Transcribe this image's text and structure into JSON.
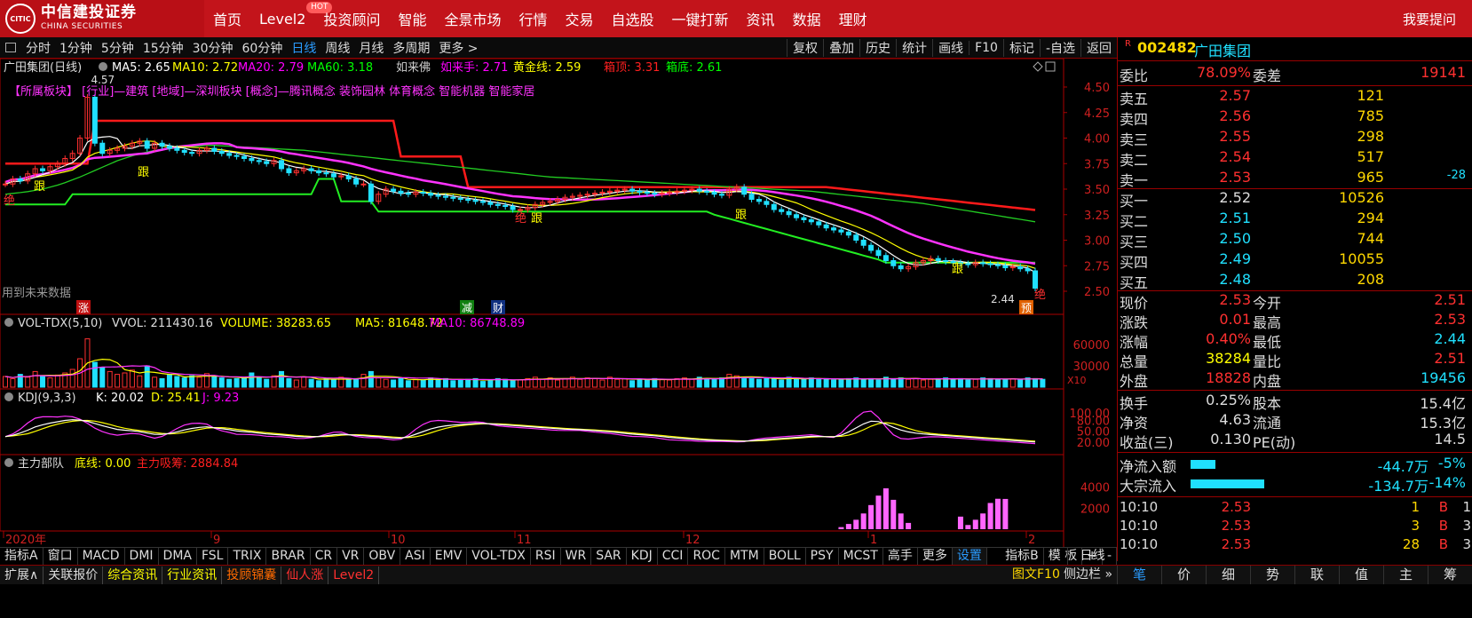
{
  "brand": {
    "logo_mark": "CITIC",
    "name_cn": "中信建投证券",
    "name_en": "CHINA SECURITIES"
  },
  "nav": [
    {
      "label": "首页"
    },
    {
      "label": "Level2",
      "badge": "HOT"
    },
    {
      "label": "投资顾问"
    },
    {
      "label": "智能"
    },
    {
      "label": "全景市场"
    },
    {
      "label": "行情"
    },
    {
      "label": "交易"
    },
    {
      "label": "自选股"
    },
    {
      "label": "一键打新"
    },
    {
      "label": "资讯"
    },
    {
      "label": "数据"
    },
    {
      "label": "理财"
    }
  ],
  "help_label": "我要提问",
  "periods": [
    "分时",
    "1分钟",
    "5分钟",
    "15分钟",
    "30分钟",
    "60分钟",
    "日线",
    "周线",
    "月线",
    "多周期",
    "更多 >"
  ],
  "active_period": "日线",
  "toolbar_right": [
    "复权",
    "叠加",
    "历史",
    "统计",
    "画线",
    "F10",
    "标记",
    "-自选",
    "返回"
  ],
  "main_legend": {
    "title": "广田集团(日线)",
    "items": [
      {
        "label": "MA5: 2.65",
        "color": "#ffffff"
      },
      {
        "label": "MA10: 2.72",
        "color": "#ffff00"
      },
      {
        "label": "MA20: 2.79",
        "color": "#ff00ff"
      },
      {
        "label": "MA60: 3.18",
        "color": "#00ff00"
      },
      {
        "label": "如来佛",
        "color": "#cccccc"
      },
      {
        "label": "如来手: 2.71",
        "color": "#ff00ff"
      },
      {
        "label": "黄金线: 2.59",
        "color": "#ffff00"
      },
      {
        "label": "箱顶: 3.31",
        "color": "#ff2020"
      },
      {
        "label": "箱底: 2.61",
        "color": "#00ff00"
      }
    ]
  },
  "sector_line": "【所属板块】 [行业]—建筑 [地域]—深圳板块 [概念]—腾讯概念 装饰园林 体育概念 智能机器 智能家居",
  "future_note": "用到未来数据",
  "markers": {
    "high": "4.57",
    "low": "2.44",
    "rise": "涨",
    "cut": "减",
    "fin": "财",
    "pre": "预",
    "jue": "绝",
    "gen": "跟"
  },
  "price_axis": [
    "4.50",
    "4.25",
    "4.00",
    "3.75",
    "3.50",
    "3.25",
    "3.00",
    "2.75",
    "2.50"
  ],
  "vol_legend": {
    "title": "VOL-TDX(5,10)",
    "items": [
      {
        "label": "VVOL: 211430.16",
        "color": "#dddddd"
      },
      {
        "label": "VOLUME: 38283.65",
        "color": "#ffff00"
      },
      {
        "label": "MA5: 81648.72",
        "color": "#ffff00"
      },
      {
        "label": "MA10: 86748.89",
        "color": "#ff00ff"
      }
    ],
    "axis": [
      "60000",
      "30000"
    ],
    "unit": "X10"
  },
  "kdj_legend": {
    "title": "KDJ(9,3,3)",
    "items": [
      {
        "label": "K: 20.02",
        "color": "#ffffff"
      },
      {
        "label": "D: 25.41",
        "color": "#ffff00"
      },
      {
        "label": "J: 9.23",
        "color": "#ff00ff"
      }
    ],
    "axis": [
      "100.00",
      "80.00",
      "50.00",
      "20.00"
    ]
  },
  "main_force_legend": {
    "title": "主力部队",
    "items": [
      {
        "label": "底线: 0.00",
        "color": "#ffff00"
      },
      {
        "label": "主力吸筹: 2884.84",
        "color": "#ff2020"
      }
    ],
    "axis": [
      "4000",
      "2000"
    ]
  },
  "time_axis": [
    "2020年",
    "9",
    "10",
    "11",
    "12",
    "1",
    "2"
  ],
  "day_button": "日线",
  "indicator_tabs": [
    "指标A",
    "窗口",
    "MACD",
    "DMI",
    "DMA",
    "FSL",
    "TRIX",
    "BRAR",
    "CR",
    "VR",
    "OBV",
    "ASI",
    "EMV",
    "VOL-TDX",
    "RSI",
    "WR",
    "SAR",
    "KDJ",
    "CCI",
    "ROC",
    "MTM",
    "BOLL",
    "PSY",
    "MCST",
    "高手",
    "更多",
    "设置"
  ],
  "indicator_tabs_right": [
    "指标B",
    "模 板",
    "+",
    "-"
  ],
  "bottom_bar": [
    {
      "label": "扩展∧",
      "color": "#dddddd"
    },
    {
      "label": "关联报价",
      "color": "#dddddd"
    },
    {
      "label": "综合资讯",
      "color": "#ffff00"
    },
    {
      "label": "行业资讯",
      "color": "#ffff00"
    },
    {
      "label": "投顾锦囊",
      "color": "#ff6a00"
    },
    {
      "label": "仙人涨",
      "color": "#ff3030"
    },
    {
      "label": "Level2",
      "color": "#ff3030"
    }
  ],
  "f10_label": "图文F10",
  "sidebar_label": "侧边栏 »",
  "right_tabs": [
    "笔",
    "价",
    "细",
    "势",
    "联",
    "值",
    "主",
    "筹"
  ],
  "quote": {
    "r_mark": "R",
    "code": "002482",
    "name": "广田集团",
    "weibi": {
      "label": "委比",
      "value": "78.09%",
      "label2": "委差",
      "value2": "19141"
    },
    "asks": [
      {
        "label": "卖五",
        "price": "2.57",
        "vol": "121",
        "chg": ""
      },
      {
        "label": "卖四",
        "price": "2.56",
        "vol": "785",
        "chg": ""
      },
      {
        "label": "卖三",
        "price": "2.55",
        "vol": "298",
        "chg": ""
      },
      {
        "label": "卖二",
        "price": "2.54",
        "vol": "517",
        "chg": ""
      },
      {
        "label": "卖一",
        "price": "2.53",
        "vol": "965",
        "chg": "-28"
      }
    ],
    "bids": [
      {
        "label": "买一",
        "price": "2.52",
        "vol": "10526"
      },
      {
        "label": "买二",
        "price": "2.51",
        "vol": "294"
      },
      {
        "label": "买三",
        "price": "2.50",
        "vol": "744"
      },
      {
        "label": "买四",
        "price": "2.49",
        "vol": "10055"
      },
      {
        "label": "买五",
        "price": "2.48",
        "vol": "208"
      }
    ],
    "stats": [
      {
        "l1": "现价",
        "v1": "2.53",
        "c1": "#ff3030",
        "l2": "今开",
        "v2": "2.51",
        "c2": "#ff3030"
      },
      {
        "l1": "涨跌",
        "v1": "0.01",
        "c1": "#ff3030",
        "l2": "最高",
        "v2": "2.53",
        "c2": "#ff3030"
      },
      {
        "l1": "涨幅",
        "v1": "0.40%",
        "c1": "#ff3030",
        "l2": "最低",
        "v2": "2.44",
        "c2": "#20e0ff"
      },
      {
        "l1": "总量",
        "v1": "38284",
        "c1": "#ffff00",
        "l2": "量比",
        "v2": "2.51",
        "c2": "#ff3030"
      },
      {
        "l1": "外盘",
        "v1": "18828",
        "c1": "#ff3030",
        "l2": "内盘",
        "v2": "19456",
        "c2": "#20e0ff"
      }
    ],
    "fund": [
      {
        "l1": "换手",
        "v1": "0.25%",
        "l2": "股本",
        "v2": "15.4亿"
      },
      {
        "l1": "净资",
        "v1": "4.63",
        "l2": "流通",
        "v2": "15.3亿"
      },
      {
        "l1": "收益(三)",
        "v1": "0.130",
        "l2": "PE(动)",
        "v2": "14.5"
      }
    ],
    "flows": [
      {
        "label": "净流入额",
        "value": "-44.7万",
        "pct": "-5%",
        "bar": 0.25
      },
      {
        "label": "大宗流入",
        "value": "-134.7万",
        "pct": "-14%",
        "bar": 0.75
      }
    ],
    "ticks": [
      {
        "time": "10:10",
        "price": "2.53",
        "vol": "1",
        "side": "B",
        "n": "1"
      },
      {
        "time": "10:10",
        "price": "2.53",
        "vol": "3",
        "side": "B",
        "n": "3"
      },
      {
        "time": "10:10",
        "price": "2.53",
        "vol": "28",
        "side": "B",
        "n": "3"
      }
    ]
  },
  "chart_data": {
    "type": "candlestick",
    "close": [
      3.55,
      3.6,
      3.58,
      3.65,
      3.7,
      3.68,
      3.72,
      3.75,
      3.8,
      3.85,
      4.0,
      4.4,
      3.95,
      3.85,
      3.88,
      3.9,
      3.92,
      3.95,
      3.97,
      3.9,
      3.95,
      3.92,
      3.9,
      3.88,
      3.86,
      3.85,
      3.88,
      3.9,
      3.87,
      3.85,
      3.83,
      3.82,
      3.8,
      3.78,
      3.77,
      3.75,
      3.78,
      3.7,
      3.66,
      3.68,
      3.7,
      3.68,
      3.66,
      3.65,
      3.62,
      3.63,
      3.6,
      3.55,
      3.55,
      3.38,
      3.45,
      3.5,
      3.48,
      3.46,
      3.45,
      3.47,
      3.46,
      3.44,
      3.43,
      3.42,
      3.41,
      3.4,
      3.39,
      3.38,
      3.37,
      3.35,
      3.34,
      3.33,
      3.3,
      3.3,
      3.32,
      3.35,
      3.37,
      3.38,
      3.4,
      3.42,
      3.43,
      3.44,
      3.45,
      3.46,
      3.47,
      3.48,
      3.49,
      3.5,
      3.48,
      3.47,
      3.46,
      3.45,
      3.46,
      3.47,
      3.48,
      3.49,
      3.5,
      3.48,
      3.47,
      3.45,
      3.44,
      3.5,
      3.52,
      3.45,
      3.4,
      3.38,
      3.35,
      3.3,
      3.28,
      3.25,
      3.22,
      3.2,
      3.18,
      3.15,
      3.12,
      3.1,
      3.08,
      3.05,
      3.0,
      2.95,
      2.9,
      2.85,
      2.8,
      2.75,
      2.72,
      2.74,
      2.78,
      2.8,
      2.82,
      2.8,
      2.79,
      2.78,
      2.77,
      2.76,
      2.78,
      2.77,
      2.76,
      2.75,
      2.73,
      2.74,
      2.72,
      2.7,
      2.53
    ],
    "ma60": [
      3.45,
      3.47,
      3.5,
      3.55,
      3.62,
      3.7,
      3.78,
      3.84,
      3.88,
      3.9,
      3.92,
      3.93,
      3.92,
      3.91,
      3.9,
      3.89,
      3.88,
      3.86,
      3.84,
      3.82,
      3.8,
      3.78,
      3.76,
      3.74,
      3.72,
      3.7,
      3.68,
      3.66,
      3.64,
      3.62,
      3.61,
      3.6,
      3.59,
      3.58,
      3.57,
      3.56,
      3.55,
      3.54,
      3.53,
      3.52,
      3.51,
      3.5,
      3.49,
      3.48,
      3.46,
      3.44,
      3.42,
      3.4,
      3.38,
      3.36,
      3.33,
      3.3,
      3.27,
      3.24,
      3.21,
      3.18
    ],
    "volume": [
      15000,
      12000,
      18000,
      14000,
      22000,
      16000,
      13000,
      17000,
      20000,
      25000,
      40000,
      68000,
      35000,
      28000,
      22000,
      18000,
      20000,
      24000,
      16000,
      30000,
      14000,
      12000,
      18000,
      15000,
      13000,
      16000,
      14000,
      19000,
      15000,
      13000,
      11000,
      12000,
      14000,
      20000,
      13000,
      11000,
      16000,
      22000,
      12000,
      10000,
      14000,
      11000,
      9000,
      12000,
      10000,
      14000,
      11000,
      12000,
      18000,
      22000,
      13000,
      11000,
      10000,
      12000,
      9000,
      11000,
      10000,
      13000,
      11000,
      12000,
      9000,
      10000,
      11000,
      12000,
      8000,
      10000,
      12000,
      11000,
      9000,
      10000,
      12000,
      14000,
      11000,
      13000,
      10000,
      12000,
      14000,
      11000,
      13000,
      12000,
      10000,
      14000,
      11000,
      12000,
      9000,
      11000,
      10000,
      12000,
      11000,
      10000,
      12000,
      13000,
      11000,
      14000,
      12000,
      11000,
      13000,
      18000,
      16000,
      14000,
      12000,
      11000,
      13000,
      12000,
      10000,
      14000,
      11000,
      12000,
      13000,
      11000,
      12000,
      10000,
      11000,
      12000,
      13000,
      11000,
      12000,
      10000,
      14000,
      12000,
      13000,
      11000,
      12000,
      10000,
      11000,
      12000,
      13000,
      11000,
      12000,
      10000,
      11000,
      13000,
      12000,
      11000,
      10000,
      12000,
      11000,
      13000,
      12000,
      11000
    ],
    "kdj_k": [
      35,
      40,
      50,
      62,
      70,
      75,
      80,
      82,
      78,
      70,
      62,
      55,
      52,
      50,
      45,
      40,
      42,
      48,
      55,
      60,
      62,
      58,
      55,
      50,
      48,
      45,
      42,
      40,
      38,
      35,
      34,
      35,
      38,
      42,
      40,
      38,
      36,
      35,
      32,
      30,
      35,
      45,
      55,
      62,
      66,
      68,
      70,
      72,
      70,
      68,
      66,
      64,
      62,
      60,
      58,
      56,
      55,
      54,
      52,
      50,
      48,
      45,
      42,
      40,
      38,
      35,
      32,
      30,
      28,
      26,
      25,
      24,
      23,
      22,
      24,
      26,
      28,
      30,
      32,
      34,
      36,
      35,
      34,
      40,
      55,
      70,
      80,
      72,
      60,
      50,
      45,
      42,
      40,
      38,
      36,
      34,
      32,
      30,
      28,
      26,
      24,
      22,
      20
    ]
  }
}
